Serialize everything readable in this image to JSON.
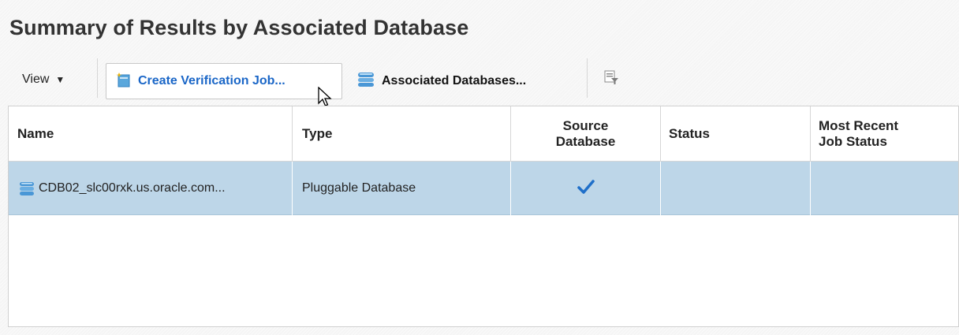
{
  "page": {
    "title": "Summary of Results by Associated Database"
  },
  "toolbar": {
    "view_label": "View",
    "create_label": "Create Verification Job...",
    "associated_label": "Associated Databases..."
  },
  "table": {
    "headers": {
      "name": "Name",
      "type": "Type",
      "source_line1": "Source",
      "source_line2": "Database",
      "status": "Status",
      "recent_line1": "Most Recent",
      "recent_line2": "Job Status"
    },
    "rows": [
      {
        "name": "CDB02_slc00rxk.us.oracle.com...",
        "type": "Pluggable Database",
        "source_database": "check-icon",
        "status": "",
        "most_recent_job_status": ""
      }
    ]
  },
  "colors": {
    "link_blue": "#1a66c7",
    "selected_row": "#bdd6e8",
    "check_blue": "#1f6fc9"
  }
}
